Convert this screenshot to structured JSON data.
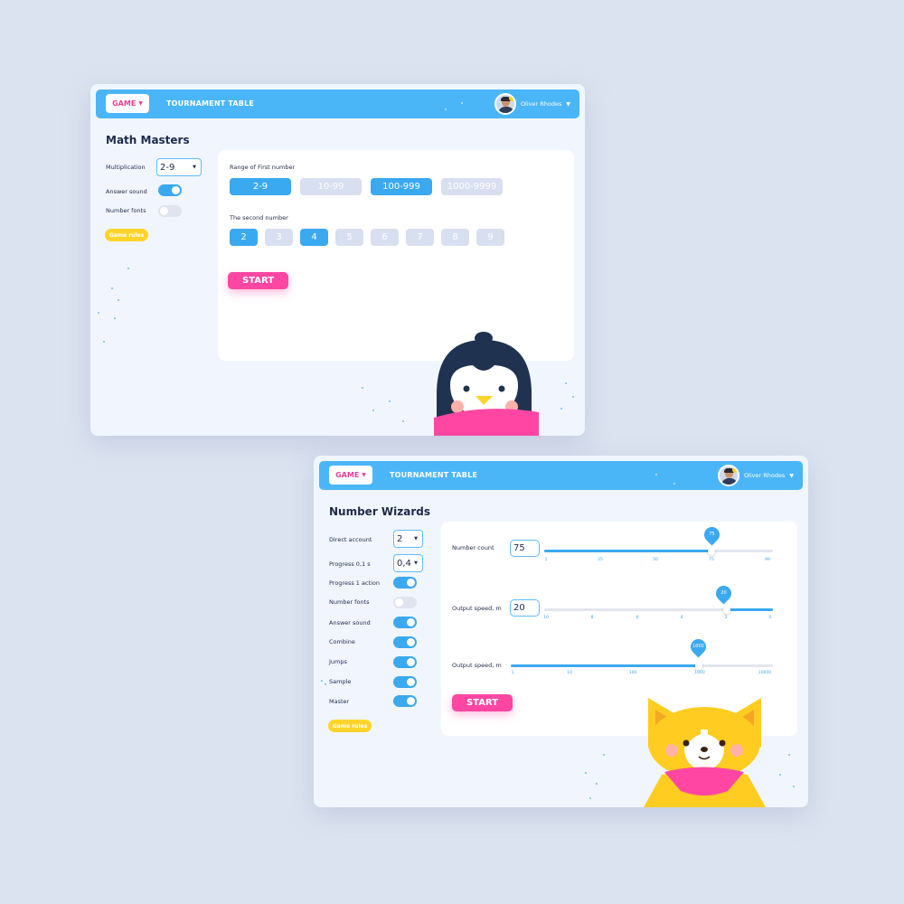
{
  "screen1": {
    "nav": {
      "game_label": "GAME",
      "tournament_label": "TOURNAMENT TABLE",
      "user_name": "Oliver Rhodes"
    },
    "title": "Math Masters",
    "options": {
      "multiplication_label": "Multiplication",
      "multiplication_value": "2-9",
      "answer_sound_label": "Answer sound",
      "answer_sound_on": true,
      "number_fonts_label": "Number fonts",
      "number_fonts_on": false,
      "rules_label": "Game rules"
    },
    "panel": {
      "range_label": "Range of First number",
      "ranges": [
        {
          "label": "2-9",
          "selected": true
        },
        {
          "label": "10-99",
          "selected": false
        },
        {
          "label": "100-999",
          "selected": true
        },
        {
          "label": "1000-9999",
          "selected": false
        }
      ],
      "second_label": "The second number",
      "seconds": [
        {
          "label": "2",
          "selected": true
        },
        {
          "label": "3",
          "selected": false
        },
        {
          "label": "4",
          "selected": true
        },
        {
          "label": "5",
          "selected": false
        },
        {
          "label": "6",
          "selected": false
        },
        {
          "label": "7",
          "selected": false
        },
        {
          "label": "8",
          "selected": false
        },
        {
          "label": "9",
          "selected": false
        }
      ],
      "start_label": "START"
    }
  },
  "screen2": {
    "nav": {
      "game_label": "GAME",
      "tournament_label": "TOURNAMENT TABLE",
      "user_name": "Oliver Rhodes"
    },
    "title": "Number Wizards",
    "options": {
      "direct_account_label": "Direct account",
      "direct_account_value": "2",
      "progress_label": "Progress 0,1 s",
      "progress_value": "0,4",
      "toggles": [
        {
          "label": "Progress 1 action",
          "on": true
        },
        {
          "label": "Number fonts",
          "on": false
        },
        {
          "label": "Answer sound",
          "on": true
        },
        {
          "label": "Combine",
          "on": true
        },
        {
          "label": "Jumps",
          "on": true
        },
        {
          "label": "Sample",
          "on": true
        },
        {
          "label": "Master",
          "on": true
        }
      ],
      "rules_label": "Game rules"
    },
    "sliders": [
      {
        "label": "Number count",
        "value": "75",
        "pin": "75",
        "ticks": [
          "1",
          "25",
          "50",
          "75",
          "99"
        ],
        "fill_fraction": 0.75,
        "fill_from": "left"
      },
      {
        "label": "Output speed, m",
        "value": "20",
        "pin": "20",
        "ticks": [
          "10",
          "8",
          "6",
          "4",
          "2",
          "0"
        ],
        "fill_fraction": 0.2,
        "fill_from": "right"
      },
      {
        "label": "Output speed, m",
        "value": "",
        "pin": "1000",
        "ticks": [
          "1",
          "10",
          "100",
          "1000",
          "10000"
        ],
        "fill_fraction": 0.75,
        "fill_from": "left"
      }
    ],
    "start_label": "START"
  },
  "colors": {
    "accent": "#4ab6f7",
    "pink": "#ff46a2",
    "yellow": "#ffd42a",
    "background": "#dce3f0"
  }
}
